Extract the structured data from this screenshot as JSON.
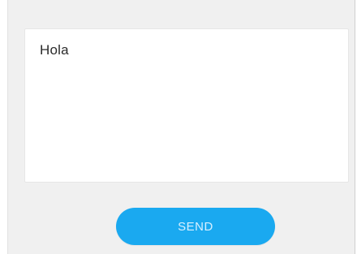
{
  "compose": {
    "message_text": "Hola",
    "send_label": "SEND"
  },
  "colors": {
    "background": "#f0f0f0",
    "send_button": "#1aa9f0",
    "send_text": "#d8f0ff",
    "text": "#2b2b2b"
  }
}
